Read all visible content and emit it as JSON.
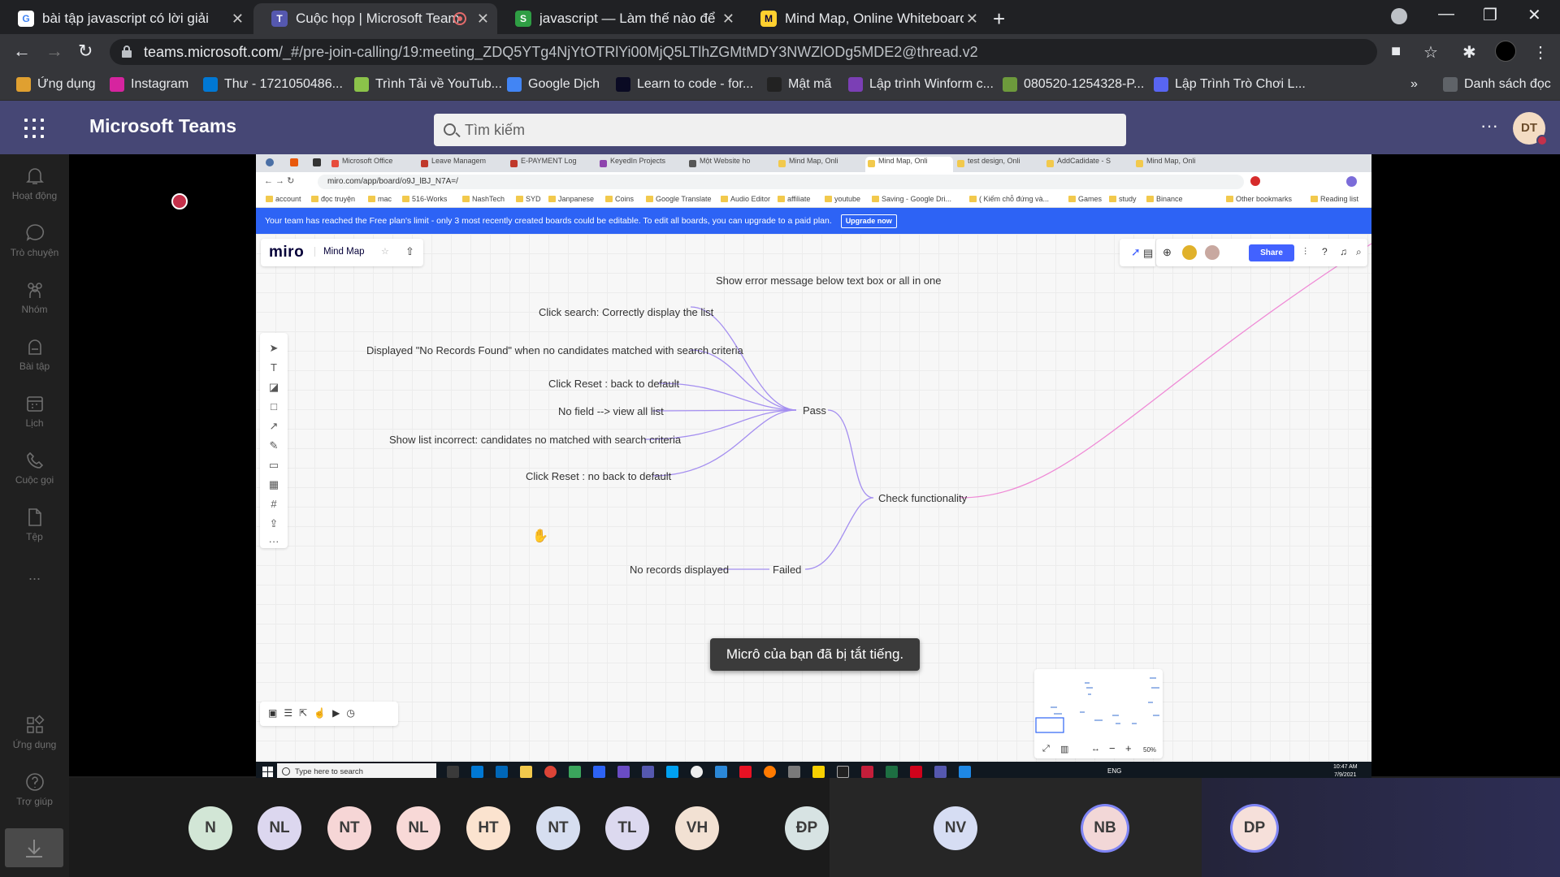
{
  "browser": {
    "tabs": [
      {
        "title": "bài tập javascript có lời giải - Tìm",
        "icon": "google-icon",
        "color": "#ffffff"
      },
      {
        "title": "Cuộc họp | Microsoft Teams",
        "icon": "teams-icon",
        "color": "#5558af"
      },
      {
        "title": "javascript — Làm thế nào để tìm",
        "icon": "stackoverflow-icon",
        "color": "#2f9e44"
      },
      {
        "title": "Mind Map, Online Whiteboard fo",
        "icon": "miro-icon",
        "color": "#ffd02f"
      }
    ],
    "url_host": "teams.microsoft.com",
    "url_rest": "/_#/pre-join-calling/19:meeting_ZDQ5YTg4NjYtOTRlYi00MjQ5LTlhZGMtMDY3NWZlODg5MDE2@thread.v2",
    "bookmarks": [
      {
        "label": "Ứng dụng",
        "color": "#e0a030"
      },
      {
        "label": "Instagram",
        "color": "#d6249f"
      },
      {
        "label": "Thư - 1721050486...",
        "color": "#0078d4"
      },
      {
        "label": "Trình Tải về YouTub...",
        "color": "#8bc34a"
      },
      {
        "label": "Google Dịch",
        "color": "#4285f4"
      },
      {
        "label": "Learn to code - for...",
        "color": "#0a0a23"
      },
      {
        "label": "Mật mã",
        "color": "#222222"
      },
      {
        "label": "Lập trình Winform c...",
        "color": "#7b3fb5"
      },
      {
        "label": "080520-1254328-P...",
        "color": "#6d9a3c"
      },
      {
        "label": "Lập Trình Trò Chơi L...",
        "color": "#5865f2"
      }
    ],
    "reading_list": "Danh sách đọc"
  },
  "teams": {
    "title": "Microsoft Teams",
    "search_placeholder": "Tìm kiếm",
    "user_initials": "DT",
    "rail": [
      {
        "label": "Hoạt động",
        "icon": "bell-icon"
      },
      {
        "label": "Trò chuyện",
        "icon": "chat-icon"
      },
      {
        "label": "Nhóm",
        "icon": "teams-group-icon"
      },
      {
        "label": "Bài tập",
        "icon": "assignments-icon"
      },
      {
        "label": "Lịch",
        "icon": "calendar-icon"
      },
      {
        "label": "Cuộc gọi",
        "icon": "phone-icon"
      },
      {
        "label": "Tệp",
        "icon": "file-icon"
      },
      {
        "label": "...",
        "icon": "more-icon"
      },
      {
        "label": "Ứng dụng",
        "icon": "apps-icon"
      },
      {
        "label": "Trợ giúp",
        "icon": "help-icon"
      }
    ],
    "toast": "Micrô của bạn đã bị tắt tiếng.",
    "participants": [
      {
        "initials": "N",
        "bg": "#d2e6d6"
      },
      {
        "initials": "NL",
        "bg": "#dcd7ef"
      },
      {
        "initials": "NT",
        "bg": "#f6d6d6"
      },
      {
        "initials": "NL",
        "bg": "#f8d9d7"
      },
      {
        "initials": "HT",
        "bg": "#fbe3cf"
      },
      {
        "initials": "NT",
        "bg": "#d6def0"
      },
      {
        "initials": "TL",
        "bg": "#dcd9ef"
      },
      {
        "initials": "VH",
        "bg": "#f2e1d3"
      },
      {
        "initials": "ĐP",
        "bg": "#d7e3e3"
      },
      {
        "initials": "NV",
        "bg": "#d6ddf3"
      },
      {
        "initials": "NB",
        "bg": "#f2d7d7"
      },
      {
        "initials": "DP",
        "bg": "#f6e0da"
      }
    ]
  },
  "shared_screen": {
    "tabs": [
      "Microsoft Office",
      "Leave Managem",
      "E-PAYMENT Log",
      "KeyedIn Projects",
      "Một Website ho",
      "Mind Map, Onli",
      "Mind Map, Onli",
      "test design, Onli",
      "AddCadidate - S",
      "Mind Map, Onli"
    ],
    "url": "miro.com/app/board/o9J_lBJ_N7A=/",
    "bookmarks": [
      "account",
      "đọc truyện",
      "mac",
      "516-Works",
      "NashTech",
      "SYD",
      "Janpanese",
      "Coins",
      "Google Translate",
      "Audio Editor",
      "affiliate",
      "youtube",
      "Saving - Google Dri...",
      "( Kiếm chỗ đứng và...",
      "Games",
      "study",
      "Binance",
      "Other bookmarks",
      "Reading list"
    ],
    "banner": "Your team has reached the Free plan's limit - only 3 most recently created boards could be editable. To edit all boards, you can upgrade to a paid plan.",
    "upgrade_label": "Upgrade now",
    "miro_logo": "miro",
    "board_name": "Mind Map",
    "share_label": "Share",
    "zoom": "50%",
    "taskbar_search": "Type here to search",
    "clock_time": "10:47 AM",
    "clock_date": "7/9/2021",
    "lang": "ENG",
    "mindmap": {
      "top_text": "Show error message below text box or all in one",
      "root": "Check functionality",
      "pass": "Pass",
      "failed": "Failed",
      "pass_children": [
        "Click search: Correctly display the list",
        "Displayed \"No Records Found\" when no candidates matched with search criteria",
        "Click Reset : back to default",
        "No field --> view all list",
        "Show list incorrect: candidates no matched with search criteria",
        "Click Reset : no back to default"
      ],
      "failed_children": [
        "No records displayed"
      ]
    }
  }
}
